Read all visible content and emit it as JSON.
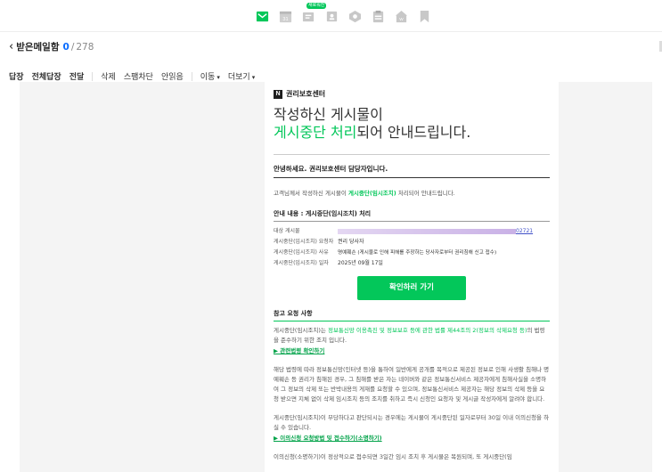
{
  "app_bar": {
    "icons": [
      "mail-icon",
      "calendar-icon",
      "memo-icon",
      "contacts-icon",
      "mybox-icon",
      "clipboard-icon",
      "home-icon",
      "bookmark-icon"
    ],
    "new_badge": "새로워진"
  },
  "mailbox": {
    "title": "받은메일함",
    "unread": "0",
    "separator": "/",
    "total": "278"
  },
  "toolbar": {
    "reply": "답장",
    "reply_all": "전체답장",
    "forward": "전달",
    "delete": "삭제",
    "spam": "스팸차단",
    "unread": "안읽음",
    "move": "이동",
    "more": "더보기"
  },
  "mail": {
    "brand": "권리보호센터",
    "brand_logo": "N",
    "headline_line1": "작성하신 게시물이",
    "headline_green": "게시중단 처리",
    "headline_rest": "되어 안내드립니다.",
    "greeting": "안녕하세요. 권리보호센터 담당자입니다.",
    "intro_prefix": "고객님께서 작성하신 게시물이 ",
    "intro_highlight": "게시중단(임시조치)",
    "intro_suffix": " 처리되어 안내드립니다.",
    "info_title": "안내 내용 : 게시중단(임시조치) 처리",
    "info_rows": [
      {
        "key": "대상 게시물",
        "value": "02721"
      },
      {
        "key": "게시중단(임시조치) 요청자",
        "value": "권리 당사자"
      },
      {
        "key": "게시중단(임시조치) 사유",
        "value": "명예훼손 (게시물로 인해 피해를 주장하는 당사자로부터 권리침해 신고 접수)"
      },
      {
        "key": "게시중단(임시조치) 일자",
        "value": "2025년 09월 17일"
      }
    ],
    "cta": "확인하러 가기",
    "ref_title": "참고 요청 사항",
    "ref_p1_prefix": "게시중단(임시조치)는 ",
    "ref_p1_link": "정보통신망 이용촉진 및 정보보호 등에 관한 법률 제44조의 2(정보의 삭제요청 등)",
    "ref_p1_suffix": "의 법령을 준수하기 위한 조치 입니다.",
    "law_link": "▶ 관련법령 확인하기",
    "ref_p2": "해당 법령에 따라 정보통신망(인터넷 등)을 통하여 일반에게 공개를 목적으로 제공된 정보로 인해 사생활 침해나 명예훼손 등 권리가 침해된 경우, 그 침해를 받은 자는 네이버와 같은 정보통신서비스 제공자에게 침해사실을 소명하여 그 정보의 삭제 또는 반박내용의 게재를 요청할 수 있으며, 정보통신서비스 제공자는 해당 정보의 삭제 등을 요청 받으면 지체 없이 삭제 임시조치 등의 조치를 취하고 즉시 신청인 요청자 및 게시글 작성자에게 알려야 합니다.",
    "ref_p3": "게시중단(임시조치)이 부당하다고 판단되시는 경우에는 게시물이 게시중단된 일자로부터 30일 이내 이의신청을 하실 수 있습니다.",
    "objection_link": "▶ 이의신청 요청방법 및 접수하기(소명하기)",
    "ref_p4": "이의신청(소명하기)이 정상적으로 접수되면 3일간 임시 조치 후 게시물은 복원되며, 또 게시중단(임"
  },
  "colors": {
    "accent_green": "#03c75a",
    "link_blue": "#0a6cff"
  }
}
